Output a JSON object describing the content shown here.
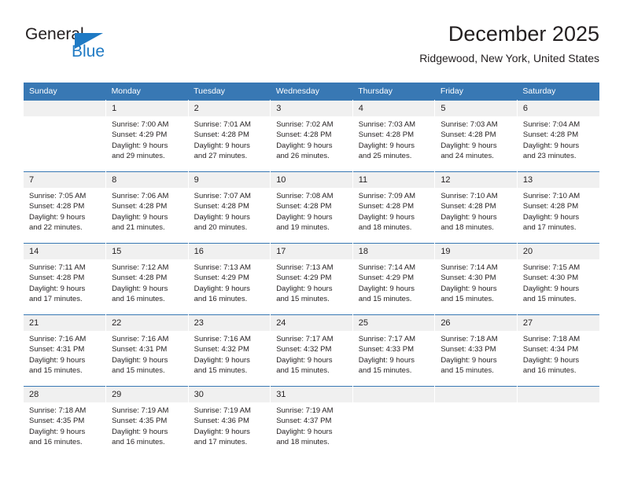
{
  "brand": {
    "name_top": "General",
    "name_bottom": "Blue",
    "accent_color": "#1f7ac4"
  },
  "header": {
    "title": "December 2025",
    "subtitle": "Ridgewood, New York, United States"
  },
  "theme": {
    "header_bar_color": "#3878b4",
    "daynum_bg": "#f0f0f0",
    "text_color": "#231f20"
  },
  "weekday_headers": [
    "Sunday",
    "Monday",
    "Tuesday",
    "Wednesday",
    "Thursday",
    "Friday",
    "Saturday"
  ],
  "labels": {
    "sunrise_prefix": "Sunrise:",
    "sunset_prefix": "Sunset:",
    "daylight_prefix": "Daylight:"
  },
  "weeks": [
    [
      {
        "day": "",
        "blank": true
      },
      {
        "day": "1",
        "sunrise": "Sunrise: 7:00 AM",
        "sunset": "Sunset: 4:29 PM",
        "daylight1": "Daylight: 9 hours",
        "daylight2": "and 29 minutes."
      },
      {
        "day": "2",
        "sunrise": "Sunrise: 7:01 AM",
        "sunset": "Sunset: 4:28 PM",
        "daylight1": "Daylight: 9 hours",
        "daylight2": "and 27 minutes."
      },
      {
        "day": "3",
        "sunrise": "Sunrise: 7:02 AM",
        "sunset": "Sunset: 4:28 PM",
        "daylight1": "Daylight: 9 hours",
        "daylight2": "and 26 minutes."
      },
      {
        "day": "4",
        "sunrise": "Sunrise: 7:03 AM",
        "sunset": "Sunset: 4:28 PM",
        "daylight1": "Daylight: 9 hours",
        "daylight2": "and 25 minutes."
      },
      {
        "day": "5",
        "sunrise": "Sunrise: 7:03 AM",
        "sunset": "Sunset: 4:28 PM",
        "daylight1": "Daylight: 9 hours",
        "daylight2": "and 24 minutes."
      },
      {
        "day": "6",
        "sunrise": "Sunrise: 7:04 AM",
        "sunset": "Sunset: 4:28 PM",
        "daylight1": "Daylight: 9 hours",
        "daylight2": "and 23 minutes."
      }
    ],
    [
      {
        "day": "7",
        "sunrise": "Sunrise: 7:05 AM",
        "sunset": "Sunset: 4:28 PM",
        "daylight1": "Daylight: 9 hours",
        "daylight2": "and 22 minutes."
      },
      {
        "day": "8",
        "sunrise": "Sunrise: 7:06 AM",
        "sunset": "Sunset: 4:28 PM",
        "daylight1": "Daylight: 9 hours",
        "daylight2": "and 21 minutes."
      },
      {
        "day": "9",
        "sunrise": "Sunrise: 7:07 AM",
        "sunset": "Sunset: 4:28 PM",
        "daylight1": "Daylight: 9 hours",
        "daylight2": "and 20 minutes."
      },
      {
        "day": "10",
        "sunrise": "Sunrise: 7:08 AM",
        "sunset": "Sunset: 4:28 PM",
        "daylight1": "Daylight: 9 hours",
        "daylight2": "and 19 minutes."
      },
      {
        "day": "11",
        "sunrise": "Sunrise: 7:09 AM",
        "sunset": "Sunset: 4:28 PM",
        "daylight1": "Daylight: 9 hours",
        "daylight2": "and 18 minutes."
      },
      {
        "day": "12",
        "sunrise": "Sunrise: 7:10 AM",
        "sunset": "Sunset: 4:28 PM",
        "daylight1": "Daylight: 9 hours",
        "daylight2": "and 18 minutes."
      },
      {
        "day": "13",
        "sunrise": "Sunrise: 7:10 AM",
        "sunset": "Sunset: 4:28 PM",
        "daylight1": "Daylight: 9 hours",
        "daylight2": "and 17 minutes."
      }
    ],
    [
      {
        "day": "14",
        "sunrise": "Sunrise: 7:11 AM",
        "sunset": "Sunset: 4:28 PM",
        "daylight1": "Daylight: 9 hours",
        "daylight2": "and 17 minutes."
      },
      {
        "day": "15",
        "sunrise": "Sunrise: 7:12 AM",
        "sunset": "Sunset: 4:28 PM",
        "daylight1": "Daylight: 9 hours",
        "daylight2": "and 16 minutes."
      },
      {
        "day": "16",
        "sunrise": "Sunrise: 7:13 AM",
        "sunset": "Sunset: 4:29 PM",
        "daylight1": "Daylight: 9 hours",
        "daylight2": "and 16 minutes."
      },
      {
        "day": "17",
        "sunrise": "Sunrise: 7:13 AM",
        "sunset": "Sunset: 4:29 PM",
        "daylight1": "Daylight: 9 hours",
        "daylight2": "and 15 minutes."
      },
      {
        "day": "18",
        "sunrise": "Sunrise: 7:14 AM",
        "sunset": "Sunset: 4:29 PM",
        "daylight1": "Daylight: 9 hours",
        "daylight2": "and 15 minutes."
      },
      {
        "day": "19",
        "sunrise": "Sunrise: 7:14 AM",
        "sunset": "Sunset: 4:30 PM",
        "daylight1": "Daylight: 9 hours",
        "daylight2": "and 15 minutes."
      },
      {
        "day": "20",
        "sunrise": "Sunrise: 7:15 AM",
        "sunset": "Sunset: 4:30 PM",
        "daylight1": "Daylight: 9 hours",
        "daylight2": "and 15 minutes."
      }
    ],
    [
      {
        "day": "21",
        "sunrise": "Sunrise: 7:16 AM",
        "sunset": "Sunset: 4:31 PM",
        "daylight1": "Daylight: 9 hours",
        "daylight2": "and 15 minutes."
      },
      {
        "day": "22",
        "sunrise": "Sunrise: 7:16 AM",
        "sunset": "Sunset: 4:31 PM",
        "daylight1": "Daylight: 9 hours",
        "daylight2": "and 15 minutes."
      },
      {
        "day": "23",
        "sunrise": "Sunrise: 7:16 AM",
        "sunset": "Sunset: 4:32 PM",
        "daylight1": "Daylight: 9 hours",
        "daylight2": "and 15 minutes."
      },
      {
        "day": "24",
        "sunrise": "Sunrise: 7:17 AM",
        "sunset": "Sunset: 4:32 PM",
        "daylight1": "Daylight: 9 hours",
        "daylight2": "and 15 minutes."
      },
      {
        "day": "25",
        "sunrise": "Sunrise: 7:17 AM",
        "sunset": "Sunset: 4:33 PM",
        "daylight1": "Daylight: 9 hours",
        "daylight2": "and 15 minutes."
      },
      {
        "day": "26",
        "sunrise": "Sunrise: 7:18 AM",
        "sunset": "Sunset: 4:33 PM",
        "daylight1": "Daylight: 9 hours",
        "daylight2": "and 15 minutes."
      },
      {
        "day": "27",
        "sunrise": "Sunrise: 7:18 AM",
        "sunset": "Sunset: 4:34 PM",
        "daylight1": "Daylight: 9 hours",
        "daylight2": "and 16 minutes."
      }
    ],
    [
      {
        "day": "28",
        "sunrise": "Sunrise: 7:18 AM",
        "sunset": "Sunset: 4:35 PM",
        "daylight1": "Daylight: 9 hours",
        "daylight2": "and 16 minutes."
      },
      {
        "day": "29",
        "sunrise": "Sunrise: 7:19 AM",
        "sunset": "Sunset: 4:35 PM",
        "daylight1": "Daylight: 9 hours",
        "daylight2": "and 16 minutes."
      },
      {
        "day": "30",
        "sunrise": "Sunrise: 7:19 AM",
        "sunset": "Sunset: 4:36 PM",
        "daylight1": "Daylight: 9 hours",
        "daylight2": "and 17 minutes."
      },
      {
        "day": "31",
        "sunrise": "Sunrise: 7:19 AM",
        "sunset": "Sunset: 4:37 PM",
        "daylight1": "Daylight: 9 hours",
        "daylight2": "and 18 minutes."
      },
      {
        "day": "",
        "blank": true
      },
      {
        "day": "",
        "blank": true
      },
      {
        "day": "",
        "blank": true
      }
    ]
  ]
}
